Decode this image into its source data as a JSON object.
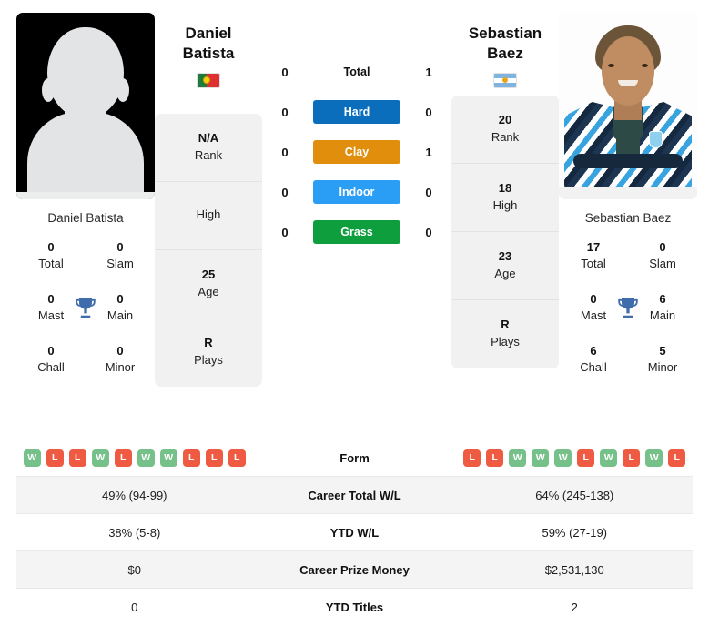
{
  "players": {
    "left": {
      "first_name": "Daniel",
      "last_name": "Batista",
      "full_name": "Daniel Batista",
      "country": "Portugal",
      "flag": "flag-portugal",
      "photo": "player-photo-placeholder",
      "rank": "N/A",
      "rank_label": "Rank",
      "high": "",
      "high_label": "High",
      "age": "25",
      "age_label": "Age",
      "plays": "R",
      "plays_label": "Plays",
      "titles": {
        "total": "0",
        "total_label": "Total",
        "slam": "0",
        "slam_label": "Slam",
        "mast": "0",
        "mast_label": "Mast",
        "main": "0",
        "main_label": "Main",
        "chall": "0",
        "chall_label": "Chall",
        "minor": "0",
        "minor_label": "Minor"
      },
      "h2h": {
        "total": "0",
        "hard": "0",
        "clay": "0",
        "indoor": "0",
        "grass": "0"
      },
      "form": [
        "W",
        "L",
        "L",
        "W",
        "L",
        "W",
        "W",
        "L",
        "L",
        "L"
      ],
      "career_wl": "49% (94-99)",
      "ytd_wl": "38% (5-8)",
      "prize_money": "$0",
      "ytd_titles": "0"
    },
    "right": {
      "first_name": "Sebastian",
      "last_name": "Baez",
      "full_name": "Sebastian Baez",
      "country": "Argentina",
      "flag": "flag-argentina",
      "photo": "player-photo",
      "rank": "20",
      "rank_label": "Rank",
      "high": "18",
      "high_label": "High",
      "age": "23",
      "age_label": "Age",
      "plays": "R",
      "plays_label": "Plays",
      "titles": {
        "total": "17",
        "total_label": "Total",
        "slam": "0",
        "slam_label": "Slam",
        "mast": "0",
        "mast_label": "Mast",
        "main": "6",
        "main_label": "Main",
        "chall": "6",
        "chall_label": "Chall",
        "minor": "5",
        "minor_label": "Minor"
      },
      "h2h": {
        "total": "1",
        "hard": "0",
        "clay": "1",
        "indoor": "0",
        "grass": "0"
      },
      "form": [
        "L",
        "L",
        "W",
        "W",
        "W",
        "L",
        "W",
        "L",
        "W",
        "L"
      ],
      "career_wl": "64% (245-138)",
      "ytd_wl": "59% (27-19)",
      "prize_money": "$2,531,130",
      "ytd_titles": "2"
    }
  },
  "surfaces": [
    {
      "label": "Total",
      "color": "",
      "plain": true
    },
    {
      "label": "Hard",
      "color": "#0a6ebd",
      "plain": false
    },
    {
      "label": "Clay",
      "color": "#e08e0b",
      "plain": false
    },
    {
      "label": "Indoor",
      "color": "#2a9df4",
      "plain": false
    },
    {
      "label": "Grass",
      "color": "#0f9e3e",
      "plain": false
    }
  ],
  "table": {
    "form_label": "Form",
    "rows": [
      {
        "label": "Career Total W/L",
        "left": "49% (94-99)",
        "right": "64% (245-138)"
      },
      {
        "label": "YTD W/L",
        "left": "38% (5-8)",
        "right": "59% (27-19)"
      },
      {
        "label": "Career Prize Money",
        "left": "$0",
        "right": "$2,531,130"
      },
      {
        "label": "YTD Titles",
        "left": "0",
        "right": "2"
      }
    ]
  },
  "colors": {
    "win": "#76c18a",
    "loss": "#ef5a43",
    "card_bg": "#f1f1f1",
    "row_alt": "#f4f4f4",
    "trophy": "#3f6cab"
  }
}
